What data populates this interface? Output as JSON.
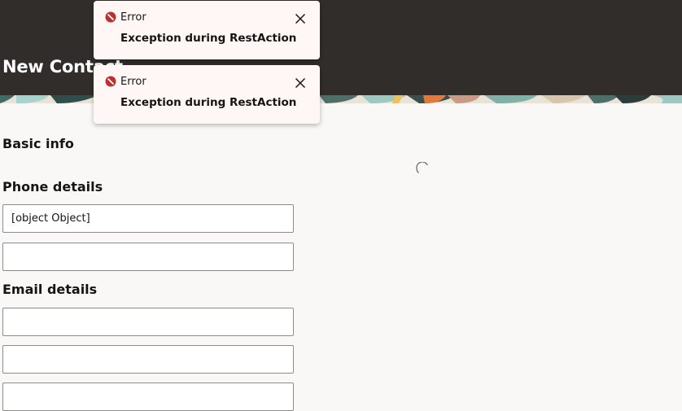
{
  "page": {
    "title": "New Contact"
  },
  "sections": {
    "basic_info": "Basic info",
    "phone_details": "Phone details",
    "email_details": "Email details"
  },
  "fields": {
    "phone_1_value": "[object Object]",
    "phone_2_value": "",
    "email_1_value": "",
    "email_2_value": "",
    "email_3_value": ""
  },
  "toasts": [
    {
      "title": "Error",
      "message": "Exception during RestAction",
      "icon": "error-icon"
    },
    {
      "title": "Error",
      "message": "Exception during RestAction",
      "icon": "error-icon"
    }
  ],
  "colors": {
    "header_bg": "#312d2a",
    "page_bg": "#faf8f6",
    "error_red": "#b83232",
    "toast_bg": "#fff7f5"
  }
}
